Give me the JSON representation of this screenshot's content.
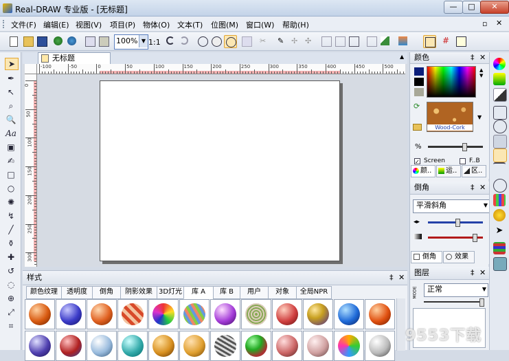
{
  "window": {
    "title": "Real-DRAW 专业版 - [无标题]"
  },
  "menu": [
    "文件(F)",
    "编辑(E)",
    "视图(V)",
    "项目(P)",
    "物体(O)",
    "文本(T)",
    "位图(M)",
    "窗口(W)",
    "帮助(H)"
  ],
  "toolbar": {
    "zoom_value": "100%",
    "ratio_label": "1:1"
  },
  "document": {
    "tab_label": "无标题"
  },
  "ruler": {
    "h_labels": [
      "-100",
      "-50",
      "0",
      "50",
      "100",
      "150",
      "200",
      "250",
      "300",
      "350",
      "400",
      "450",
      "500"
    ],
    "v_labels": [
      "0",
      "50",
      "100",
      "150",
      "200",
      "250",
      "300"
    ]
  },
  "styles_panel": {
    "title": "样式",
    "tabs": [
      "颜色纹理",
      "透明度",
      "倒角",
      "阴影效果",
      "3D灯光",
      "库 A",
      "库 B",
      "用户",
      "对象",
      "全局NPR"
    ],
    "active_tab": "库 A"
  },
  "color_panel": {
    "title": "颜色",
    "texture_label": "Wood-Cork",
    "percent_label": "%",
    "screen_label": "Screen",
    "fill_label": "F..B",
    "tabs": [
      "颜..",
      "运..",
      "区.."
    ]
  },
  "bevel_panel": {
    "title": "倒角",
    "mode_value": "平滑斜角",
    "tabs": [
      "倒角",
      "效果"
    ]
  },
  "layer_panel": {
    "title": "图层",
    "mode_value": "正常",
    "mode_label": "MODE"
  },
  "watermark": "9553下载"
}
